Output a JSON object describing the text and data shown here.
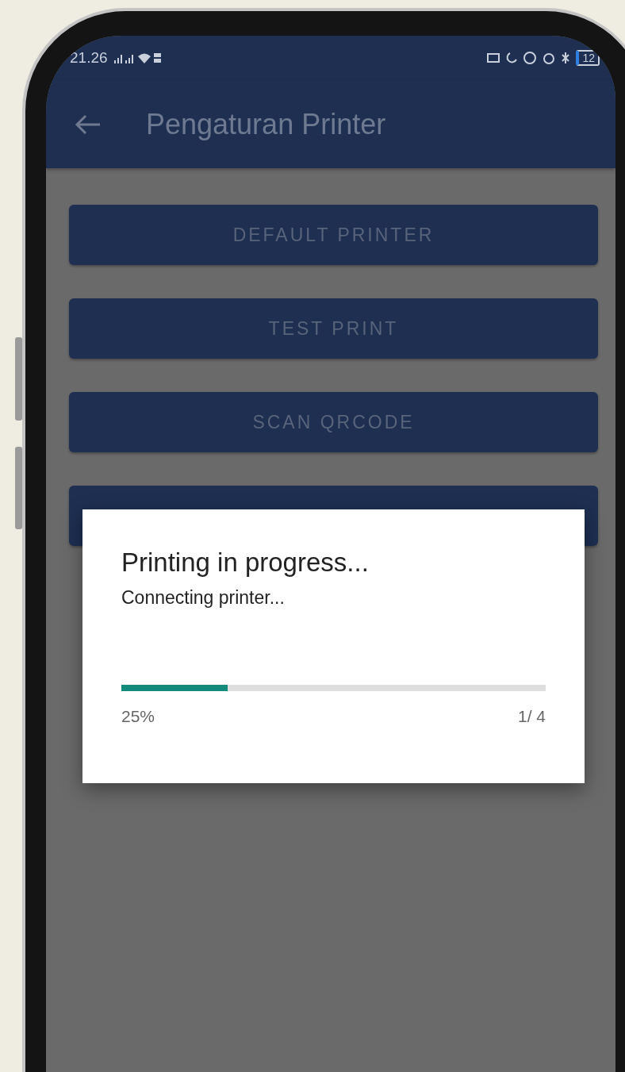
{
  "status_bar": {
    "time": "21.26",
    "battery": "12"
  },
  "app_bar": {
    "title": "Pengaturan Printer"
  },
  "buttons": [
    {
      "label": "DEFAULT PRINTER"
    },
    {
      "label": "TEST PRINT"
    },
    {
      "label": "SCAN QRCODE"
    }
  ],
  "dialog": {
    "title": "Printing in progress...",
    "message": "Connecting printer...",
    "progress": {
      "level": 0.25
    },
    "percent": "25%",
    "count": "1/ 4"
  }
}
